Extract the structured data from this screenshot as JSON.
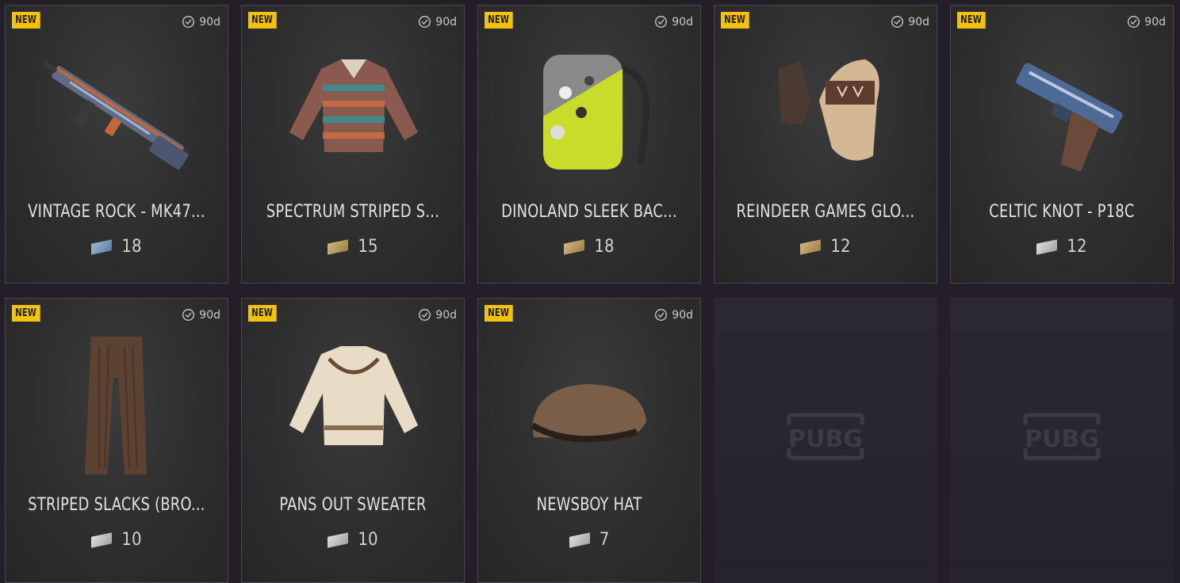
{
  "items": [
    {
      "badge": "NEW",
      "duration": "90d",
      "name": "VINTAGE ROCK - MK47...",
      "cost": "18",
      "ticket": "blue",
      "icon": "rifle-icon"
    },
    {
      "badge": "NEW",
      "duration": "90d",
      "name": "SPECTRUM STRIPED S...",
      "cost": "15",
      "ticket": "gold",
      "icon": "sweater-icon"
    },
    {
      "badge": "NEW",
      "duration": "90d",
      "name": "DINOLAND SLEEK BAC...",
      "cost": "18",
      "ticket": "gold",
      "icon": "backpack-icon"
    },
    {
      "badge": "NEW",
      "duration": "90d",
      "name": "REINDEER GAMES GLO...",
      "cost": "12",
      "ticket": "gold",
      "icon": "gloves-icon"
    },
    {
      "badge": "NEW",
      "duration": "90d",
      "name": "CELTIC KNOT - P18C",
      "cost": "12",
      "ticket": "silver",
      "icon": "pistol-icon"
    },
    {
      "badge": "NEW",
      "duration": "90d",
      "name": "STRIPED SLACKS (BRO...",
      "cost": "10",
      "ticket": "silver",
      "icon": "pants-icon"
    },
    {
      "badge": "NEW",
      "duration": "90d",
      "name": "PANS OUT SWEATER",
      "cost": "10",
      "ticket": "silver",
      "icon": "knit-sweater-icon"
    },
    {
      "badge": "NEW",
      "duration": "90d",
      "name": "NEWSBOY HAT",
      "cost": "7",
      "ticket": "silver",
      "icon": "hat-icon"
    }
  ],
  "empty_slots": [
    {
      "logo": "PUBG"
    },
    {
      "logo": "PUBG"
    }
  ],
  "colors": {
    "badge": "#f2c20f",
    "background": "#231e28",
    "ticket_blue": "#7a9cbc",
    "ticket_gold": "#b89a5e",
    "ticket_silver": "#c4c4c4"
  }
}
